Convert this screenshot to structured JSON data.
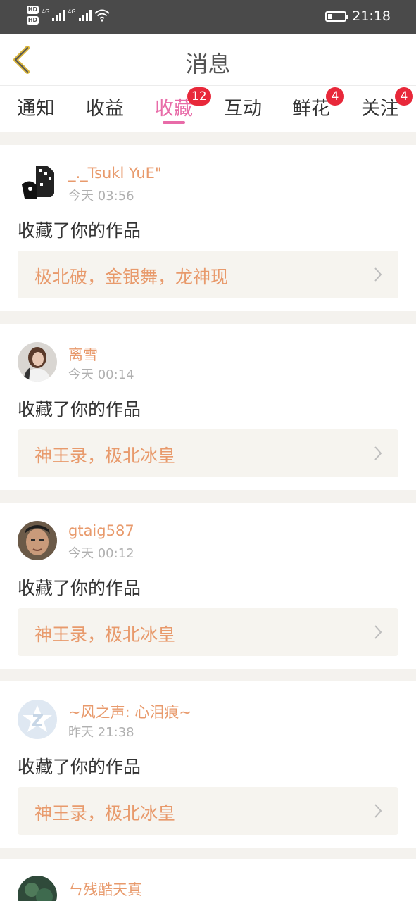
{
  "status_bar": {
    "hd1": "HD",
    "hd2": "HD",
    "net1": "4G",
    "net2": "4G",
    "time": "21:18"
  },
  "header": {
    "title": "消息"
  },
  "tabs": [
    {
      "label": "通知",
      "badge": ""
    },
    {
      "label": "收益",
      "badge": ""
    },
    {
      "label": "收藏",
      "badge": "12"
    },
    {
      "label": "互动",
      "badge": ""
    },
    {
      "label": "鲜花",
      "badge": "4"
    },
    {
      "label": "关注",
      "badge": "4"
    }
  ],
  "active_tab": "收藏",
  "colors": {
    "accent": "#e86ba8",
    "name": "#e89a6c",
    "badge": "#e8283a"
  },
  "notifications": [
    {
      "user": "_._Tsukl YuE\"",
      "time": "今天 03:56",
      "action": "收藏了你的作品",
      "work": "极北破，金银舞，龙神现"
    },
    {
      "user": "离雪",
      "time": "今天 00:14",
      "action": "收藏了你的作品",
      "work": "神王录，极北冰皇"
    },
    {
      "user": "gtaig587",
      "time": "今天 00:12",
      "action": "收藏了你的作品",
      "work": "神王录，极北冰皇"
    },
    {
      "user": "~风之声: 心泪痕~",
      "time": "昨天 21:38",
      "action": "收藏了你的作品",
      "work": "神王录，极北冰皇"
    },
    {
      "user": "ㄣ残酷天真",
      "time": "",
      "action": "",
      "work": ""
    }
  ]
}
